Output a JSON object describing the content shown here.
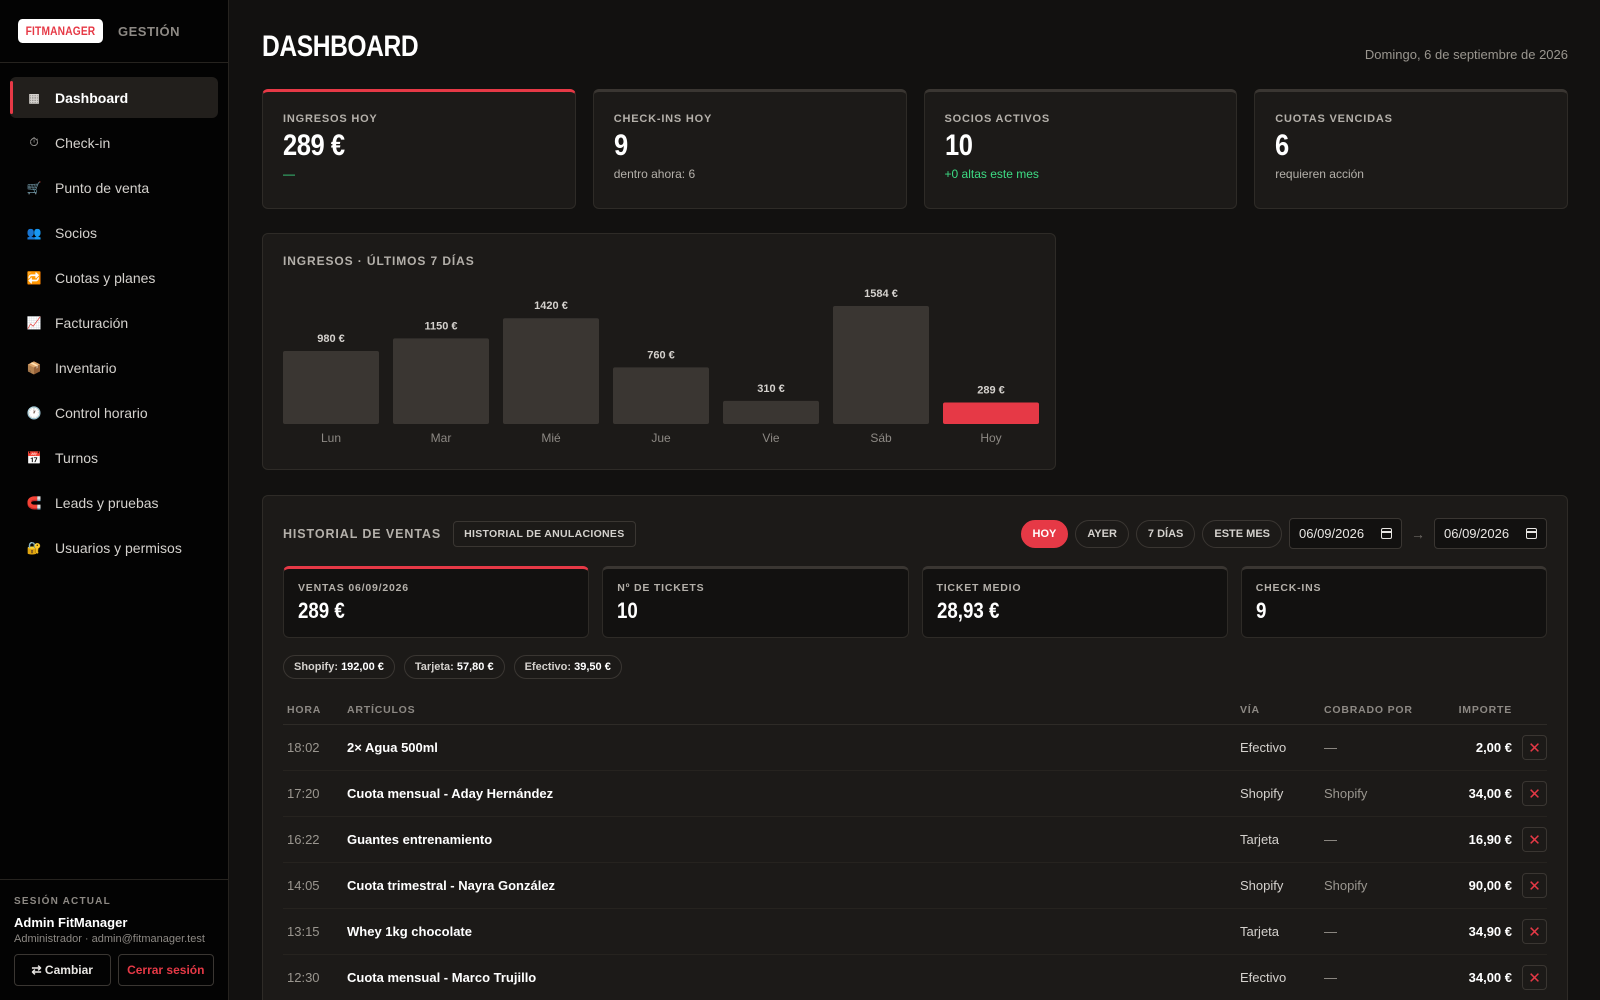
{
  "brand": {
    "logo": "FITMANAGER",
    "sub": "GESTIÓN"
  },
  "sidebar": {
    "items": [
      {
        "label": "Dashboard",
        "icon": "grid-icon",
        "glyph": "▦",
        "color": "#d4d1cd",
        "active": true
      },
      {
        "label": "Check-in",
        "icon": "stopwatch-icon",
        "glyph": "⏱",
        "color": "#d4d1cd"
      },
      {
        "label": "Punto de venta",
        "icon": "cart-icon",
        "glyph": "🛒",
        "color": "#d4d1cd"
      },
      {
        "label": "Socios",
        "icon": "people-icon",
        "glyph": "👥",
        "color": "#8a7fd8"
      },
      {
        "label": "Cuotas y planes",
        "icon": "repeat-icon",
        "glyph": "🔁",
        "color": "#4aa3f0"
      },
      {
        "label": "Facturación",
        "icon": "chart-up-icon",
        "glyph": "📈",
        "color": "#d4d1cd"
      },
      {
        "label": "Inventario",
        "icon": "package-icon",
        "glyph": "📦",
        "color": "#d4a25a"
      },
      {
        "label": "Control horario",
        "icon": "clock-icon",
        "glyph": "🕐",
        "color": "#d4d1cd"
      },
      {
        "label": "Turnos",
        "icon": "calendar-icon",
        "glyph": "📅",
        "color": "#6c8ef0"
      },
      {
        "label": "Leads y pruebas",
        "icon": "magnet-icon",
        "glyph": "🧲",
        "color": "#e63946"
      },
      {
        "label": "Usuarios y permisos",
        "icon": "lock-icon",
        "glyph": "🔐",
        "color": "#e8b84a"
      }
    ]
  },
  "session": {
    "label": "SESIÓN ACTUAL",
    "name": "Admin FitManager",
    "role": "Administrador · admin@fitmanager.test",
    "change": "⇄ Cambiar",
    "logout": "Cerrar sesión"
  },
  "header": {
    "title": "DASHBOARD",
    "date": "Domingo, 6 de septiembre de 2026"
  },
  "kpis": [
    {
      "label": "INGRESOS HOY",
      "value": "289 €",
      "sub": "—",
      "sub_color": "green"
    },
    {
      "label": "CHECK-INS HOY",
      "value": "9",
      "sub": "dentro ahora: 6",
      "sub_color": "muted"
    },
    {
      "label": "SOCIOS ACTIVOS",
      "value": "10",
      "sub": "+0 altas este mes",
      "sub_color": "green"
    },
    {
      "label": "CUOTAS VENCIDAS",
      "value": "6",
      "sub": "requieren acción",
      "sub_color": "muted"
    }
  ],
  "revenue_chart": {
    "title": "INGRESOS · ÚLTIMOS 7 DÍAS",
    "chart_data": {
      "type": "bar",
      "categories": [
        "Lun",
        "Mar",
        "Mié",
        "Jue",
        "Vie",
        "Sáb",
        "Hoy"
      ],
      "values": [
        980,
        1150,
        1420,
        760,
        310,
        1584,
        289
      ],
      "value_labels": [
        "980 €",
        "1150 €",
        "1420 €",
        "760 €",
        "310 €",
        "1584 €",
        "289 €"
      ],
      "highlight_index": 6,
      "bar_color": "#3a3632",
      "highlight_color": "#e63946"
    }
  },
  "sales": {
    "title": "HISTORIAL DE VENTAS",
    "cancellations_button": "HISTORIAL DE ANULACIONES",
    "filters": [
      "HOY",
      "AYER",
      "7 DÍAS",
      "ESTE MES"
    ],
    "active_filter": 0,
    "date_from": "06/09/2026",
    "date_to": "06/09/2026",
    "summary": [
      {
        "label": "VENTAS 06/09/2026",
        "value": "289 €"
      },
      {
        "label": "Nº DE TICKETS",
        "value": "10"
      },
      {
        "label": "TICKET MEDIO",
        "value": "28,93 €"
      },
      {
        "label": "CHECK-INS",
        "value": "9"
      }
    ],
    "chips": [
      {
        "label": "Shopify:",
        "value": "192,00 €"
      },
      {
        "label": "Tarjeta:",
        "value": "57,80 €"
      },
      {
        "label": "Efectivo:",
        "value": "39,50 €"
      }
    ],
    "columns": {
      "hora": "HORA",
      "articulos": "ARTÍCULOS",
      "via": "VÍA",
      "cobrado": "COBRADO POR",
      "importe": "IMPORTE"
    },
    "rows": [
      {
        "hora": "18:02",
        "articulos": "2× Agua 500ml",
        "via": "Efectivo",
        "cobrado": "—",
        "importe": "2,00 €"
      },
      {
        "hora": "17:20",
        "articulos": "Cuota mensual - Aday Hernández",
        "via": "Shopify",
        "cobrado": "Shopify",
        "importe": "34,00 €"
      },
      {
        "hora": "16:22",
        "articulos": "Guantes entrenamiento",
        "via": "Tarjeta",
        "cobrado": "—",
        "importe": "16,90 €"
      },
      {
        "hora": "14:05",
        "articulos": "Cuota trimestral - Nayra González",
        "via": "Shopify",
        "cobrado": "Shopify",
        "importe": "90,00 €"
      },
      {
        "hora": "13:15",
        "articulos": "Whey 1kg chocolate",
        "via": "Tarjeta",
        "cobrado": "—",
        "importe": "34,90 €"
      },
      {
        "hora": "12:30",
        "articulos": "Cuota mensual - Marco Trujillo",
        "via": "Efectivo",
        "cobrado": "—",
        "importe": "34,00 €"
      }
    ],
    "delete_glyph": "✕"
  }
}
